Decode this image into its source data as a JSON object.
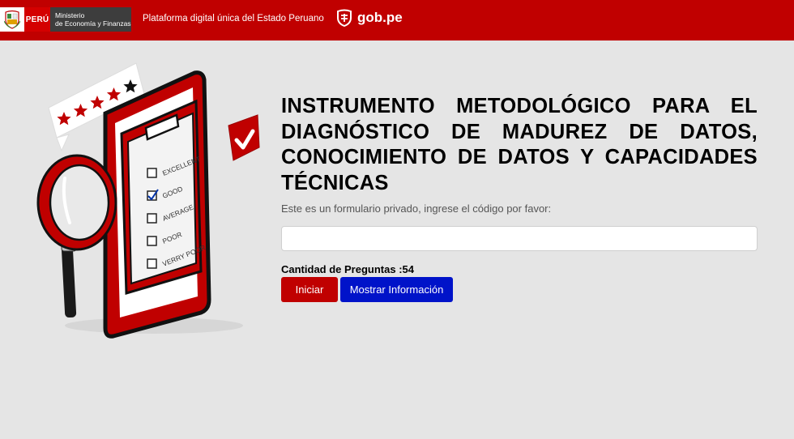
{
  "header": {
    "brand_country": "PERÚ",
    "brand_ministry_line1": "Ministerio",
    "brand_ministry_line2": "de Economía y Finanzas",
    "platform_text": "Plataforma digital única del Estado Peruano",
    "gob_label": "gob.pe"
  },
  "illustration": {
    "options": [
      "EXCELLENT",
      "GOOD",
      "AVERAGE",
      "POOR",
      "VERRY POOR"
    ],
    "checked_option": "GOOD",
    "stars_filled": 4,
    "stars_total": 5
  },
  "main": {
    "title": "INSTRUMENTO METODOLÓGICO PARA EL DIAGNÓSTICO DE MADUREZ DE DATOS, CONOCIMIENTO DE DATOS Y CAPACIDADES TÉCNICAS",
    "subtitle": "Este es un formulario privado, ingrese el código por favor:",
    "input_value": "",
    "question_count_label": "Cantidad de Preguntas :54",
    "start_button": "Iniciar",
    "info_button": "Mostrar Información"
  },
  "colors": {
    "header_red": "#c00000",
    "start_button": "#c00000",
    "info_button": "#0013c9",
    "background": "#e5e5e5"
  }
}
